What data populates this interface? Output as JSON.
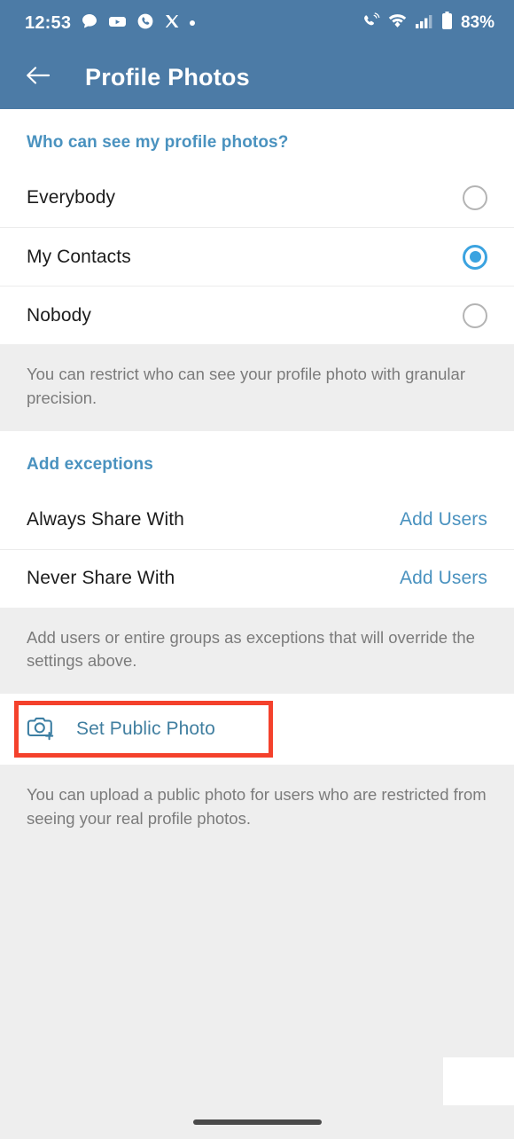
{
  "status_bar": {
    "time": "12:53",
    "battery_percent": "83%",
    "left_icons": [
      "chat-bubble-icon",
      "youtube-icon",
      "phone-circle-icon",
      "x-twitter-icon",
      "dot-icon"
    ],
    "right_icons": [
      "call-mute-icon",
      "wifi-icon",
      "signal-bars-icon",
      "battery-icon"
    ],
    "background_color": "#4c7ba6"
  },
  "app_bar": {
    "back_icon": "arrow-left-icon",
    "title": "Profile Photos",
    "background_color": "#4c7ba6",
    "text_color": "#ffffff"
  },
  "visibility_section": {
    "header": "Who can see my profile photos?",
    "options": [
      {
        "label": "Everybody",
        "selected": false
      },
      {
        "label": "My Contacts",
        "selected": true
      },
      {
        "label": "Nobody",
        "selected": false
      }
    ],
    "note": "You can restrict who can see your profile photo with granular precision."
  },
  "exceptions_section": {
    "header": "Add exceptions",
    "rows": [
      {
        "label": "Always Share With",
        "action": "Add Users"
      },
      {
        "label": "Never Share With",
        "action": "Add Users"
      }
    ],
    "note": "Add users or entire groups as exceptions that will override the settings above."
  },
  "public_photo_section": {
    "icon": "camera-plus-icon",
    "label": "Set Public Photo",
    "note": "You can upload a public photo for users who are restricted from seeing your real profile photos.",
    "highlighted": true,
    "highlight_color": "#f4412c"
  },
  "colors": {
    "accent_blue": "#4a92bf",
    "radio_selected": "#3ba3e0",
    "link_teal": "#417fa0",
    "page_background": "#eeeeee",
    "card_background": "#ffffff",
    "muted_text": "#7b7b7b"
  }
}
